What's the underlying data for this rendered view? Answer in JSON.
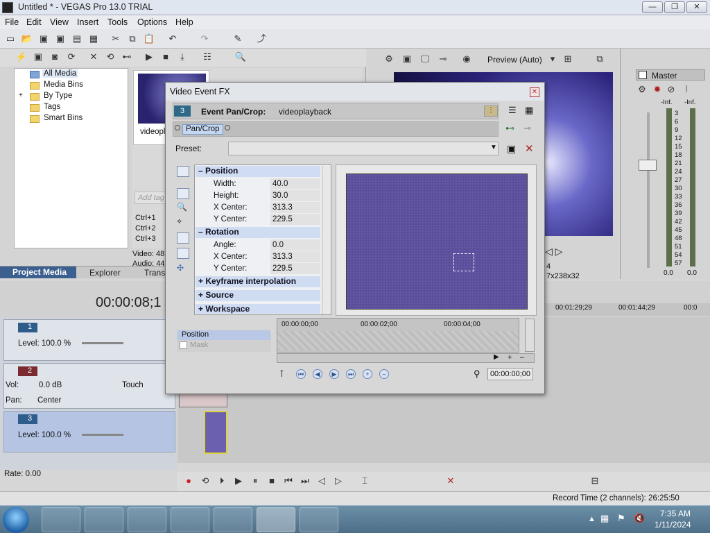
{
  "window": {
    "title": "Untitled * - VEGAS Pro 13.0 TRIAL",
    "min": "—",
    "max": "❐",
    "close": "✕"
  },
  "menu": [
    "File",
    "Edit",
    "View",
    "Insert",
    "Tools",
    "Options",
    "Help"
  ],
  "media_tree": [
    "All Media",
    "Media Bins",
    "By Type",
    "Tags",
    "Smart Bins"
  ],
  "media": {
    "thumb_label": "videopla",
    "add_tag": "Add tag",
    "shortcuts": [
      "Ctrl+1",
      "Ctrl+2",
      "Ctrl+3"
    ],
    "video_info": "Video: 48",
    "audio_info": "Audio: 44"
  },
  "left_tabs": [
    "Project Media",
    "Explorer",
    "Transi"
  ],
  "preview": {
    "mode": "Preview (Auto)",
    "frame": "4",
    "size": "7x238x32"
  },
  "master": {
    "label": "Master",
    "meter_top": [
      "-Inf.",
      "-Inf."
    ],
    "scale": [
      "3",
      "6",
      "9",
      "12",
      "15",
      "18",
      "21",
      "24",
      "27",
      "30",
      "33",
      "36",
      "39",
      "42",
      "45",
      "48",
      "51",
      "54",
      "57"
    ],
    "meter_bottom": [
      "0.0",
      "0.0"
    ]
  },
  "timeline": {
    "timecode": "00:00:08;1",
    "ruler": [
      "00:01:29;29",
      "00:01:44;29",
      "00:0"
    ],
    "tracks": [
      {
        "num": "1",
        "line1": "Level: 100.0 %"
      },
      {
        "num": "2",
        "vol_label": "Vol:",
        "vol": "0.0 dB",
        "pan_label": "Pan:",
        "pan": "Center",
        "touch": "Touch"
      },
      {
        "num": "3",
        "line1": "Level: 100.0 %"
      }
    ],
    "rate": "Rate: 0.00"
  },
  "status": {
    "record_time": "Record Time (2 channels): 26:25:50"
  },
  "clock": {
    "time": "7:35 AM",
    "date": "1/11/2024"
  },
  "dialog": {
    "title": "Video Event FX",
    "fx_num": "3",
    "fx_label": "Event Pan/Crop:",
    "fx_name": "videoplayback",
    "plugin": "Pan/Crop",
    "preset_label": "Preset:",
    "groups": [
      {
        "name": "Position",
        "rows": [
          [
            "Width:",
            "40.0"
          ],
          [
            "Height:",
            "30.0"
          ],
          [
            "X Center:",
            "313.3"
          ],
          [
            "Y Center:",
            "229.5"
          ]
        ]
      },
      {
        "name": "Rotation",
        "rows": [
          [
            "Angle:",
            "0.0"
          ],
          [
            "X Center:",
            "313.3"
          ],
          [
            "Y Center:",
            "229.5"
          ]
        ]
      }
    ],
    "collapsed_groups": [
      "Keyframe interpolation",
      "Source",
      "Workspace"
    ],
    "kf_rows": [
      "Position",
      "Mask"
    ],
    "ruler": [
      "00:00:00;00",
      "00:00:02;00",
      "00:00:04;00"
    ],
    "kf_time": "00:00:00;00"
  }
}
